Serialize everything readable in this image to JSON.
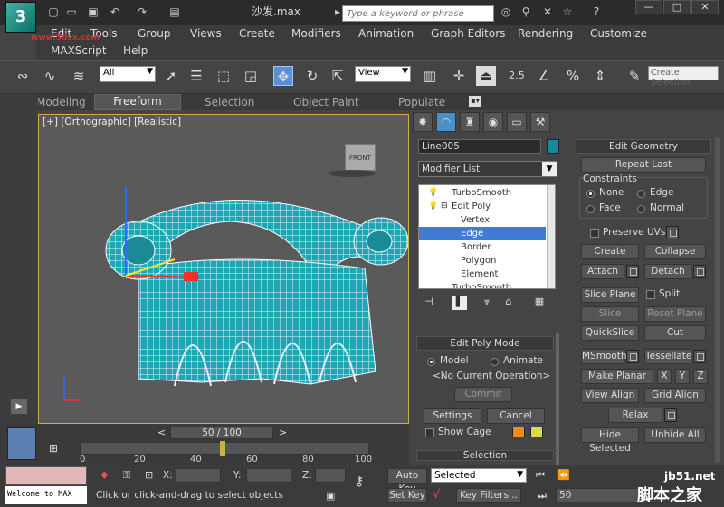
{
  "titlebar": {
    "logo": "3",
    "doc_title": "沙发.max",
    "search_placeholder": "Type a keyword or phrase",
    "win_min": "—",
    "win_max": "□",
    "win_close": "✕"
  },
  "watermark_top": "www.3dsx.com",
  "menus": [
    "Edit",
    "Tools",
    "Group",
    "Views",
    "Create",
    "Modifiers",
    "Animation",
    "Graph Editors",
    "Rendering",
    "Customize",
    "MAXScript",
    "Help"
  ],
  "toolbar": {
    "filter": "All",
    "ref_coord": "View",
    "snap_angle": "2.5",
    "percent_snap": "%",
    "create_selection": "Create Selection"
  },
  "ribbon_tabs": [
    "Modeling",
    "Freeform",
    "Selection",
    "Object Paint",
    "Populate"
  ],
  "viewport": {
    "label": "[+] [Orthographic] [Realistic]",
    "viewcube_text": "FRONT"
  },
  "command_panel": {
    "object_name": "Line005",
    "object_color": "#1789a0",
    "modifier_list": "Modifier List",
    "stack": [
      {
        "label": "TurboSmooth",
        "selected": false
      },
      {
        "label": "Edit Poly",
        "selected": false
      },
      {
        "label": "Vertex",
        "selected": false
      },
      {
        "label": "Edge",
        "selected": true
      },
      {
        "label": "Border",
        "selected": false
      },
      {
        "label": "Polygon",
        "selected": false
      },
      {
        "label": "Element",
        "selected": false
      },
      {
        "label": "TurboSmooth",
        "selected": false
      }
    ],
    "edit_poly_mode": {
      "title": "Edit Poly Mode",
      "model": "Model",
      "animate": "Animate",
      "current_op": "<No Current Operation>",
      "commit": "Commit",
      "settings": "Settings",
      "cancel": "Cancel",
      "show_cage": "Show Cage"
    },
    "selection_title": "Selection",
    "edit_geometry": {
      "title": "Edit Geometry",
      "repeat_last": "Repeat Last",
      "constraints": "Constraints",
      "none": "None",
      "edge": "Edge",
      "face": "Face",
      "normal": "Normal",
      "preserve_uvs": "Preserve UVs",
      "create": "Create",
      "collapse": "Collapse",
      "attach": "Attach",
      "detach": "Detach",
      "slice_plane": "Slice Plane",
      "split": "Split",
      "slice": "Slice",
      "reset_plane": "Reset Plane",
      "quickslice": "QuickSlice",
      "cut": "Cut",
      "msmooth": "MSmooth",
      "tessellate": "Tessellate",
      "make_planar": "Make Planar",
      "x": "X",
      "y": "Y",
      "z": "Z",
      "view_align": "View Align",
      "grid_align": "Grid Align",
      "relax": "Relax",
      "hide_selected": "Hide Selected",
      "unhide_all": "Unhide All"
    }
  },
  "timeline": {
    "slider": "50 / 100",
    "prev": "<",
    "next": ">",
    "ticks": [
      "0",
      "20",
      "40",
      "60",
      "80",
      "100"
    ]
  },
  "status": {
    "maxscript": "Welcome to MAX",
    "message": "Click or click-and-drag to select objects",
    "x_label": "X:",
    "y_label": "Y:",
    "z_label": "Z:",
    "auto_key": "Auto Key",
    "set_key": "Set Key",
    "selected": "Selected",
    "key_filters": "Key Filters...",
    "frame": "50"
  },
  "watermark_br": {
    "line1": "jb51.net",
    "line2": "脚本之家"
  }
}
